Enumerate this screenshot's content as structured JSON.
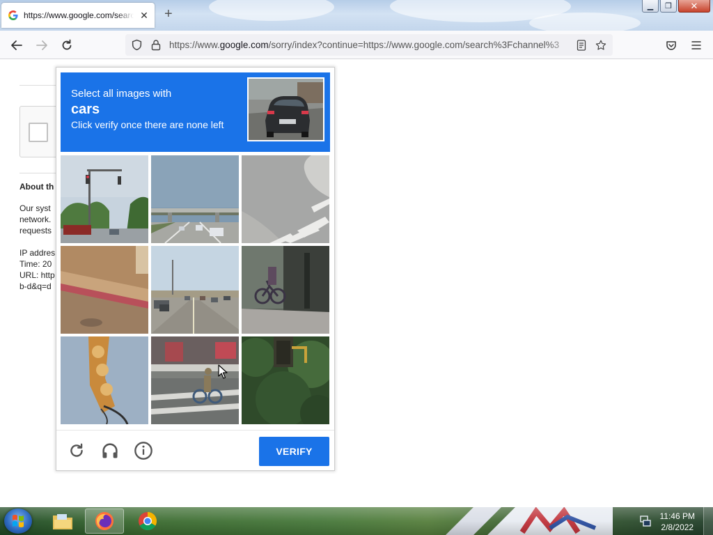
{
  "browser": {
    "tab_title": "https://www.google.com/search",
    "tab_close": "✕",
    "new_tab": "+",
    "url_prefix": "https://www.",
    "url_host": "google.com",
    "url_rest": "/sorry/index?continue=https://www.google.com/search%3Fchannel%3"
  },
  "page": {
    "heading": "About th",
    "paragraph_lines": [
      "Our syst",
      "network.",
      "requests"
    ],
    "ip_label": "IP addres",
    "time_label": "Time: 20",
    "url_label": "URL: http",
    "extra_line": "b-d&q=d"
  },
  "captcha": {
    "line1": "Select all images with",
    "line2": "cars",
    "line3": "Click verify once there are none left",
    "verify_label": "VERIFY",
    "tiles": [
      {
        "name": "traffic-light-street"
      },
      {
        "name": "highway-overpass"
      },
      {
        "name": "crosswalk-road"
      },
      {
        "name": "curb-closeup"
      },
      {
        "name": "road-with-cars"
      },
      {
        "name": "bicycle-wall"
      },
      {
        "name": "traffic-light-closeup"
      },
      {
        "name": "cyclist-crosswalk"
      },
      {
        "name": "traffic-light-trees"
      }
    ]
  },
  "taskbar": {
    "time": "11:46 PM",
    "date": "2/8/2022"
  }
}
